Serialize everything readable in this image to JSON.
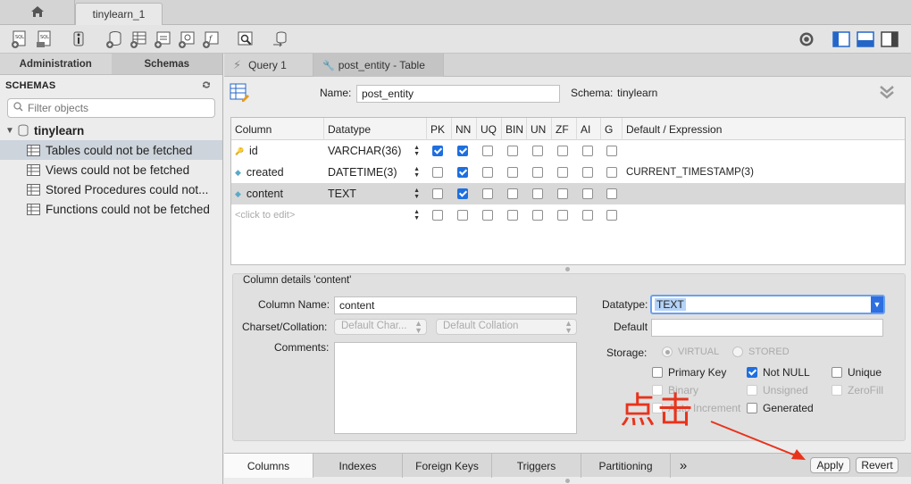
{
  "tabbar": {
    "connection_tab": "tinylearn_1"
  },
  "sidebar": {
    "tabs": [
      "Administration",
      "Schemas"
    ],
    "title": "SCHEMAS",
    "filter_placeholder": "Filter objects",
    "schema_name": "tinylearn",
    "items": [
      "Tables could not be fetched",
      "Views could not be fetched",
      "Stored Procedures could not...",
      "Functions could not be fetched"
    ]
  },
  "editor": {
    "tabs": [
      "Query 1",
      "post_entity - Table"
    ],
    "name_label": "Name:",
    "name_value": "post_entity",
    "schema_label": "Schema:",
    "schema_value": "tinylearn"
  },
  "grid": {
    "headers": [
      "Column",
      "Datatype",
      "PK",
      "NN",
      "UQ",
      "BIN",
      "UN",
      "ZF",
      "AI",
      "G",
      "Default / Expression"
    ],
    "rows": [
      {
        "name": "id",
        "datatype": "VARCHAR(36)",
        "flags": [
          true,
          true,
          false,
          false,
          false,
          false,
          false,
          false
        ],
        "default": ""
      },
      {
        "name": "created",
        "datatype": "DATETIME(3)",
        "flags": [
          false,
          true,
          false,
          false,
          false,
          false,
          false,
          false
        ],
        "default": "CURRENT_TIMESTAMP(3)"
      },
      {
        "name": "content",
        "datatype": "TEXT",
        "flags": [
          false,
          true,
          false,
          false,
          false,
          false,
          false,
          false
        ],
        "default": ""
      }
    ],
    "new_row_placeholder": "<click to edit>"
  },
  "details": {
    "title": "Column details 'content'",
    "column_name_label": "Column Name:",
    "column_name_value": "content",
    "charset_label": "Charset/Collation:",
    "charset_placeholder": "Default Char...",
    "collation_placeholder": "Default Collation",
    "comments_label": "Comments:",
    "datatype_label": "Datatype:",
    "datatype_value": "TEXT",
    "default_label": "Default",
    "storage_label": "Storage:",
    "storage_virtual": "VIRTUAL",
    "storage_stored": "STORED",
    "opt_primary_key": "Primary Key",
    "opt_not_null": "Not NULL",
    "opt_unique": "Unique",
    "opt_binary": "Binary",
    "opt_unsigned": "Unsigned",
    "opt_zerofill": "ZeroFill",
    "opt_auto_increment": "Auto Increment",
    "opt_generated": "Generated"
  },
  "bottom_tabs": [
    "Columns",
    "Indexes",
    "Foreign Keys",
    "Triggers",
    "Partitioning"
  ],
  "more_tabs_glyph": "»",
  "buttons": {
    "apply": "Apply",
    "revert": "Revert"
  },
  "annotation": {
    "text": "点击",
    "color": "#e8331c"
  }
}
